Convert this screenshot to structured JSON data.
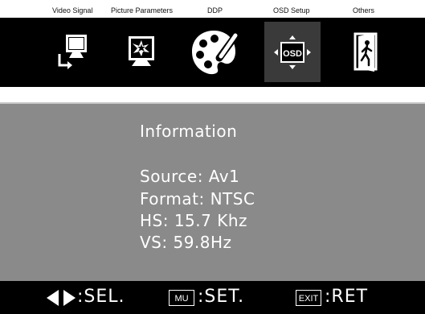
{
  "tabs": [
    {
      "label": "Video Signal",
      "icon": "video-signal-icon"
    },
    {
      "label": "Picture Parameters",
      "icon": "picture-parameters-icon"
    },
    {
      "label": "DDP",
      "icon": "ddp-palette-icon"
    },
    {
      "label": "OSD Setup",
      "icon": "osd-setup-icon",
      "selected": true,
      "badge": "OSD"
    },
    {
      "label": "Others",
      "icon": "others-door-icon"
    }
  ],
  "info": {
    "title": "Information",
    "source": "Source: Av1",
    "format": "Format: NTSC",
    "hs": "HS: 15.7 Khz",
    "vs": "VS: 59.8Hz"
  },
  "hints": {
    "sel": ":SEL.",
    "menu_key": "MU",
    "set": ":SET.",
    "exit_key": "EXIT",
    "ret": ":RET"
  },
  "colors": {
    "menu_bg": "#000000",
    "selected_bg": "#3a3a3a",
    "panel_bg": "#8a8a8a"
  }
}
